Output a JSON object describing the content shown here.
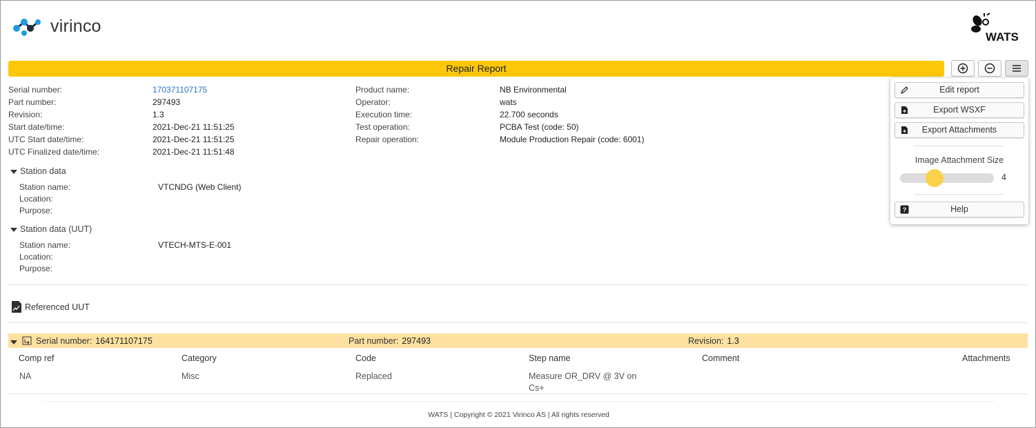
{
  "brand": {
    "logo_text": "virinco",
    "app_logo": "WATS"
  },
  "report": {
    "title": "Repair Report"
  },
  "toolbar": {
    "zoom_in_icon": "plus-circle-icon",
    "zoom_out_icon": "minus-circle-icon",
    "menu_icon": "hamburger-icon"
  },
  "info_left": [
    {
      "label": "Serial number:",
      "value": "170371107175"
    },
    {
      "label": "Part number:",
      "value": "297493"
    },
    {
      "label": "Revision:",
      "value": "1.3"
    },
    {
      "label": "Start date/time:",
      "value": "2021-Dec-21 11:51:25"
    },
    {
      "label": "UTC Start date/time:",
      "value": "2021-Dec-21 11:51:25"
    },
    {
      "label": "UTC Finalized date/time:",
      "value": "2021-Dec-21 11:51:48"
    }
  ],
  "info_right": [
    {
      "label": "Product name:",
      "value": "NB Environmental"
    },
    {
      "label": "Operator:",
      "value": "wats"
    },
    {
      "label": "Execution time:",
      "value": "22.700 seconds"
    },
    {
      "label": "Test operation:",
      "value": "PCBA Test (code: 50)"
    },
    {
      "label": "Repair operation:",
      "value": "Module Production Repair (code: 6001)"
    }
  ],
  "station": {
    "title": "Station data",
    "rows": [
      {
        "label": "Station name:",
        "value": "VTCNDG (Web Client)"
      },
      {
        "label": "Location:",
        "value": ""
      },
      {
        "label": "Purpose:",
        "value": ""
      }
    ]
  },
  "station_uut": {
    "title": "Station data (UUT)",
    "rows": [
      {
        "label": "Station name:",
        "value": "VTECH-MTS-E-001"
      },
      {
        "label": "Location:",
        "value": ""
      },
      {
        "label": "Purpose:",
        "value": ""
      }
    ]
  },
  "referenced_uut": {
    "label": "Referenced UUT"
  },
  "uut_band": {
    "serial_label": "Serial number:",
    "serial_value": "164171107175",
    "part_label": "Part number:",
    "part_value": "297493",
    "revision_label": "Revision:",
    "revision_value": "1.3"
  },
  "repair_table": {
    "headers": [
      "Comp ref",
      "Category",
      "Code",
      "Step name",
      "Comment",
      "Attachments"
    ],
    "rows": [
      {
        "comp_ref": "NA",
        "category": "Misc",
        "code": "Replaced",
        "step_name": "Measure OR_DRV @ 3V on Cs+",
        "comment": "",
        "attachments": ""
      }
    ]
  },
  "menu": {
    "edit": "Edit report",
    "export_wsxf": "Export WSXF",
    "export_attachments": "Export Attachments",
    "slider_label": "Image Attachment Size",
    "slider_value": "4",
    "slider_level": 0.37,
    "help": "Help"
  },
  "footer": {
    "text": "WATS | Copyright © 2021 Virinco AS | All rights reserved"
  },
  "colors": {
    "title_bar": "#fcc70b",
    "serial_band": "#fde1a0",
    "link": "#2a73c4",
    "slider_thumb": "#fcd14a"
  }
}
